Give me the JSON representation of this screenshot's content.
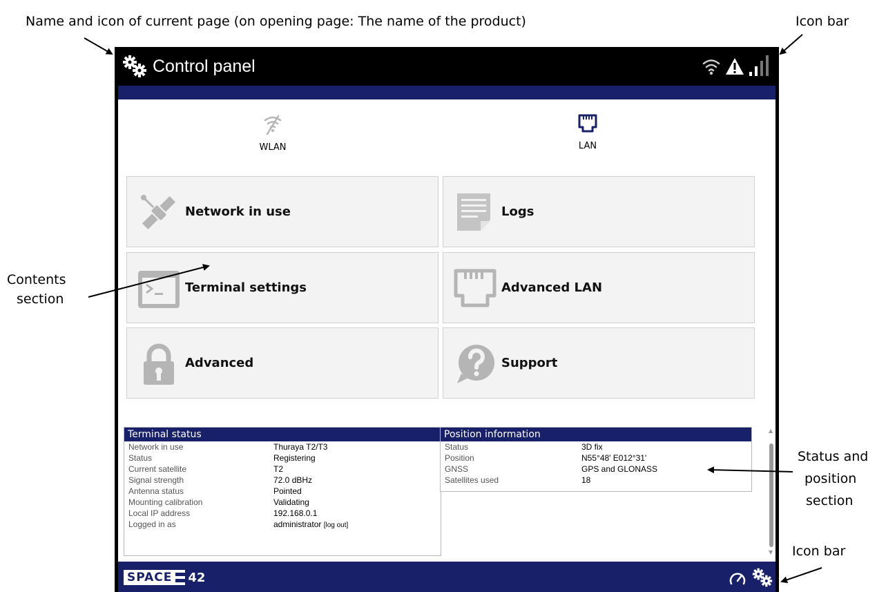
{
  "annotations": {
    "page_name": "Name and icon of current page (on opening page: The name of the product)",
    "icon_bar_top": "Icon bar",
    "contents_line1": "Contents",
    "contents_line2": "section",
    "status_line1": "Status and",
    "status_line2": "position",
    "status_line3": "section",
    "icon_bar_bottom": "Icon bar"
  },
  "topbar": {
    "title": "Control panel",
    "icons": [
      "gears-icon",
      "wifi-icon",
      "warning-icon",
      "signal-bars-icon"
    ]
  },
  "network": {
    "wlan_label": "WLAN",
    "lan_label": "LAN"
  },
  "tiles": [
    {
      "label": "Network in use",
      "icon": "satellite-icon"
    },
    {
      "label": "Logs",
      "icon": "document-icon"
    },
    {
      "label": "Terminal settings",
      "icon": "terminal-icon"
    },
    {
      "label": "Advanced LAN",
      "icon": "ethernet-port-icon"
    },
    {
      "label": "Advanced",
      "icon": "lock-icon"
    },
    {
      "label": "Support",
      "icon": "help-icon"
    }
  ],
  "terminal_status": {
    "title": "Terminal status",
    "rows": [
      {
        "key": "Network in use",
        "value": "Thuraya T2/T3"
      },
      {
        "key": "Status",
        "value": "Registering"
      },
      {
        "key": "Current satellite",
        "value": "T2"
      },
      {
        "key": "Signal strength",
        "value": "72.0 dBHz"
      },
      {
        "key": "Antenna status",
        "value": "Pointed"
      },
      {
        "key": "Mounting calibration",
        "value": "Validating"
      },
      {
        "key": "Local IP address",
        "value": "192.168.0.1"
      },
      {
        "key": "Logged in as",
        "value": "administrator"
      }
    ],
    "logout_label": "[log out]"
  },
  "position_info": {
    "title": "Position information",
    "rows": [
      {
        "key": "Status",
        "value": "3D fix"
      },
      {
        "key": "Position",
        "value": "N55°48' E012°31'"
      },
      {
        "key": "GNSS",
        "value": "GPS and GLONASS"
      },
      {
        "key": "Satellites used",
        "value": "18"
      }
    ]
  },
  "bottombar": {
    "logo_part1": "SPACE",
    "logo_part2": "42",
    "icons": [
      "dashboard-gauge-icon",
      "gears-icon"
    ]
  },
  "colors": {
    "brand_blue": "#18206a",
    "top_bar": "#000000",
    "tile_bg": "#f3f3f3",
    "icon_gray": "#b5b5b5"
  }
}
